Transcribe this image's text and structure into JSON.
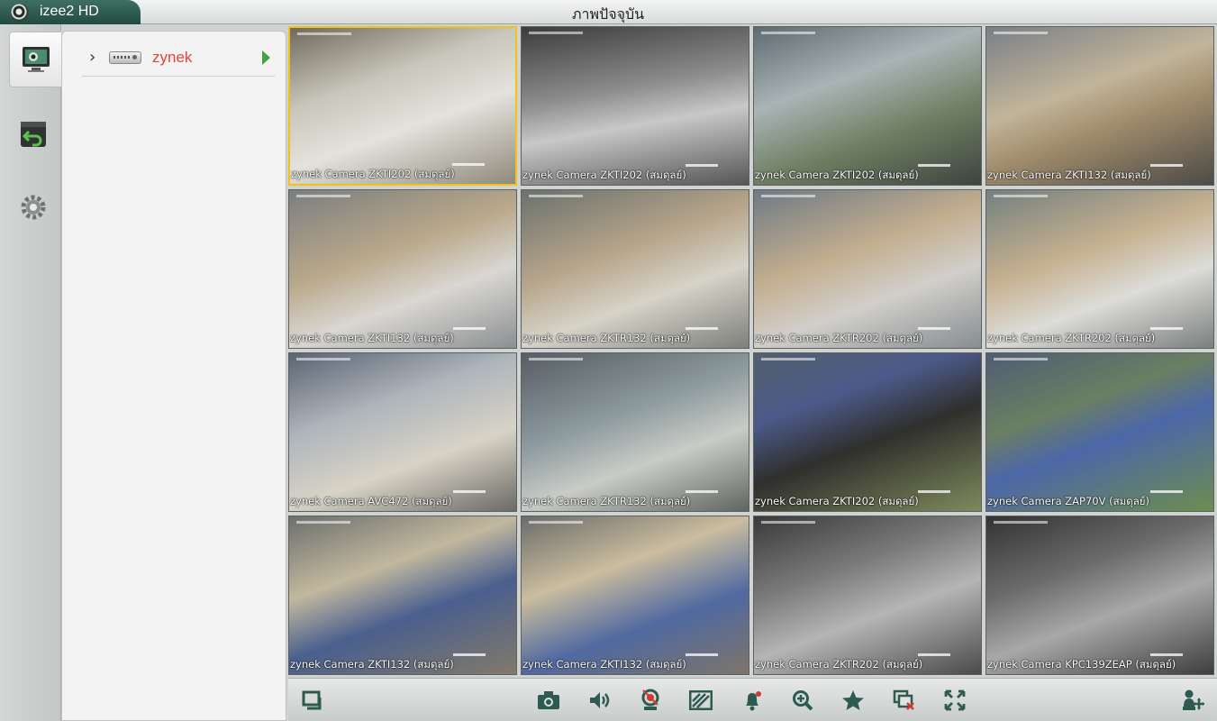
{
  "app": {
    "name": "izee2 HD",
    "title": "ภาพปัจจุบัน"
  },
  "colors": {
    "accent": "#2e5b50",
    "device_text": "#e0443c",
    "play": "#3ea33a",
    "selected_border": "#f2c21b"
  },
  "rail": [
    {
      "icon": "live-view-icon",
      "active": true
    },
    {
      "icon": "playback-icon",
      "active": false
    },
    {
      "icon": "settings-gear-icon",
      "active": false
    }
  ],
  "device": {
    "name": "zynek"
  },
  "cameras": [
    "zynek Camera ZKTI202 (สมดุลย์)",
    "zynek Camera ZKTI202 (สมดุลย์)",
    "zynek Camera ZKTI202 (สมดุลย์)",
    "zynek Camera ZKTI132 (สมดุลย์)",
    "zynek Camera ZKTI132 (สมดุลย์)",
    "zynek Camera ZKTR132 (สมดุลย์)",
    "zynek Camera ZKTR202 (สมดุลย์)",
    "zynek Camera ZKTR202 (สมดุลย์)",
    "zynek Camera AVC472 (สมดุลย์)",
    "zynek Camera ZKTR132 (สมดุลย์)",
    "zynek Camera ZKTI202 (สมดุลย์)",
    "zynek Camera ZAP70V (สมดุลย์)",
    "zynek Camera ZKTI132 (สมดุลย์)",
    "zynek Camera ZKTI132 (สมดุลย์)",
    "zynek Camera ZKTR202 (สมดุลย์)",
    "zynek Camera KPC139ZEAP (สมดุลย์)"
  ],
  "selected_cell": 0,
  "toolbar": [
    "split-layout-icon",
    "snapshot-camera-icon",
    "audio-speaker-icon",
    "record-icon",
    "image-adjust-icon",
    "alarm-bell-icon",
    "zoom-in-icon",
    "favorite-star-icon",
    "close-all-windows-icon",
    "fullscreen-icon",
    "ptz-control-icon"
  ]
}
